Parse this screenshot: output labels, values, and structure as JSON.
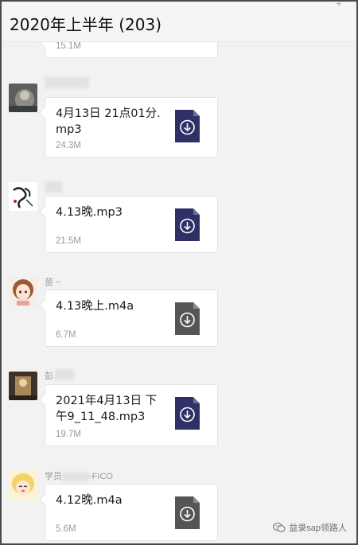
{
  "header": {
    "title": "2020年上半年 (203)",
    "plus_label": "+"
  },
  "messages": [
    {
      "sender": "",
      "file_name": "",
      "file_size": "15.1M",
      "icon_color": "#2f3066"
    },
    {
      "sender": "",
      "file_name": "4月13日 21点01分.mp3",
      "file_size": "24.3M",
      "icon_color": "#2f3066"
    },
    {
      "sender": "",
      "file_name": "4.13晚.mp3",
      "file_size": "21.5M",
      "icon_color": "#2f3066"
    },
    {
      "sender": "苗 ~",
      "file_name": "4.13晚上.m4a",
      "file_size": "6.7M",
      "icon_color": "#555555"
    },
    {
      "sender": "彭",
      "file_name": "2021年4月13日 下午9_11_48.mp3",
      "file_size": "19.7M",
      "icon_color": "#2f3066"
    },
    {
      "sender": "学员",
      "sender_suffix": "-FICO",
      "file_name": "4.12晚.m4a",
      "file_size": "5.6M",
      "icon_color": "#555555"
    }
  ],
  "watermark": {
    "text": "益录sap领路人",
    "icon": "wechat-icon"
  },
  "icons": {
    "file": "download-file-icon",
    "add": "plus-icon"
  }
}
